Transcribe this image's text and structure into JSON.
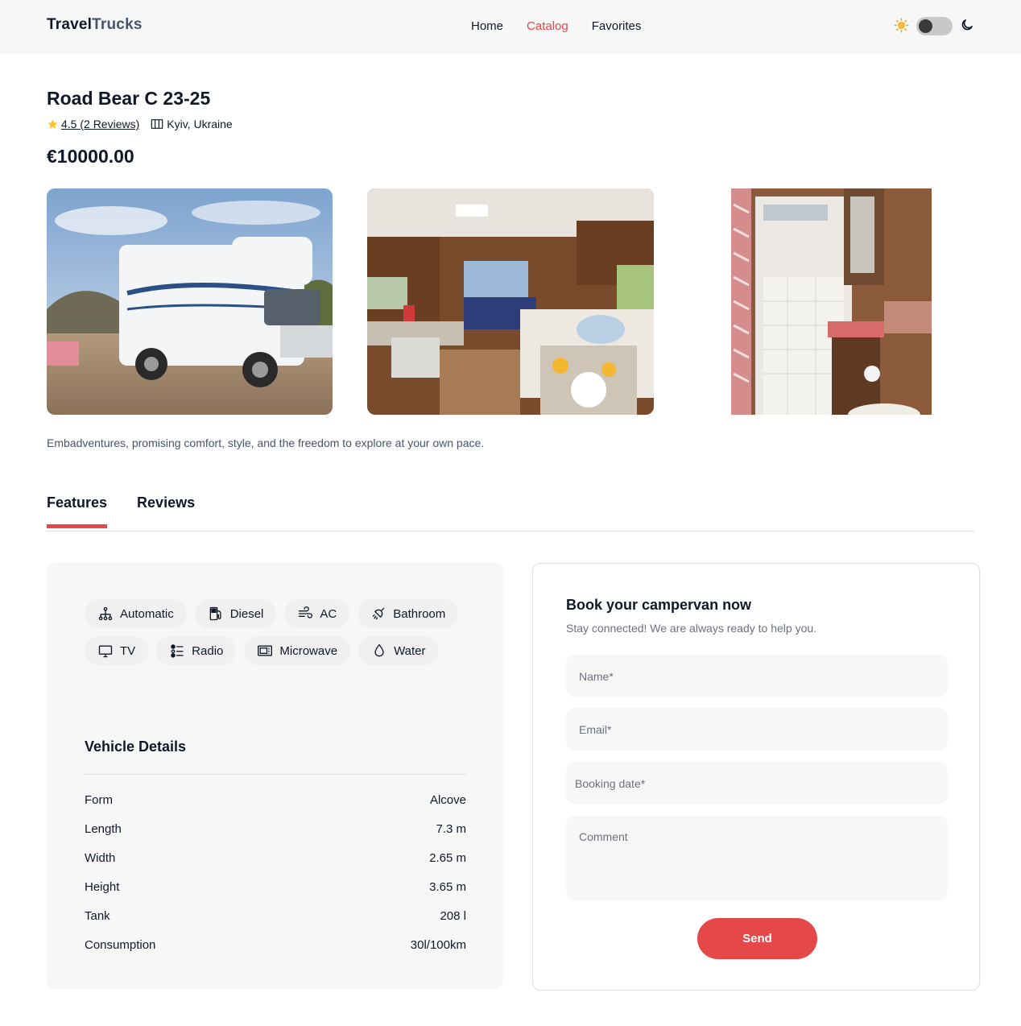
{
  "header": {
    "logo_part1": "Travel",
    "logo_part2": "Trucks",
    "nav": [
      {
        "label": "Home"
      },
      {
        "label": "Catalog"
      },
      {
        "label": "Favorites"
      }
    ],
    "active_nav": "Catalog",
    "theme_toggle": "light"
  },
  "camper": {
    "name": "Road Bear C 23-25",
    "rating_text": "4.5 (2 Reviews)",
    "location": "Kyiv, Ukraine",
    "price": "€10000.00",
    "description": "Embadventures, promising comfort, style, and the freedom to explore at your own pace."
  },
  "tabs": [
    {
      "label": "Features"
    },
    {
      "label": "Reviews"
    }
  ],
  "features": [
    {
      "label": "Automatic",
      "icon": "transmission-icon"
    },
    {
      "label": "Diesel",
      "icon": "fuel-pump-icon"
    },
    {
      "label": "AC",
      "icon": "wind-icon"
    },
    {
      "label": "Bathroom",
      "icon": "shower-icon"
    },
    {
      "label": "TV",
      "icon": "tv-icon"
    },
    {
      "label": "Radio",
      "icon": "radio-icon"
    },
    {
      "label": "Microwave",
      "icon": "microwave-icon"
    },
    {
      "label": "Water",
      "icon": "water-drop-icon"
    }
  ],
  "vehicle_details": {
    "title": "Vehicle Details",
    "rows": [
      {
        "label": "Form",
        "value": "Alcove"
      },
      {
        "label": "Length",
        "value": "7.3 m"
      },
      {
        "label": "Width",
        "value": "2.65 m"
      },
      {
        "label": "Height",
        "value": "3.65 m"
      },
      {
        "label": "Tank",
        "value": "208 l"
      },
      {
        "label": "Consumption",
        "value": "30l/100km"
      }
    ]
  },
  "booking": {
    "title": "Book your campervan now",
    "subtitle": "Stay connected! We are always ready to help you.",
    "name_placeholder": "Name*",
    "email_placeholder": "Email*",
    "date_placeholder": "Booking date*",
    "comment_placeholder": "Comment",
    "send_label": "Send"
  },
  "colors": {
    "accent": "#e44848",
    "text": "#101828",
    "panel_bg": "#f7f7f7",
    "star": "#ffc531"
  }
}
